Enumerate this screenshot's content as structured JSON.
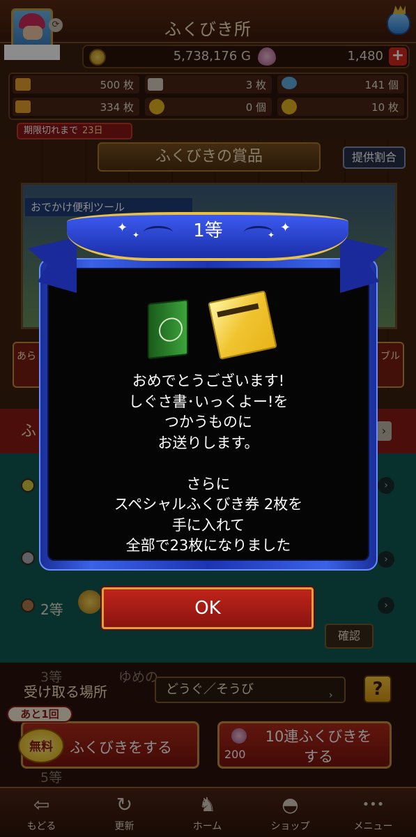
{
  "header": {
    "title": "ふくびき所"
  },
  "currency": {
    "gold": "5,738,176 G",
    "gems": "1,480",
    "plus": "+"
  },
  "inventory": [
    {
      "value": "500 枚",
      "icon_color": "#e8a030"
    },
    {
      "value": "3 枚",
      "icon_color": "#d8d0c0"
    },
    {
      "value": "141 個",
      "icon_color": "#60b0e0"
    },
    {
      "value": "334 枚",
      "icon_color": "#e8a030"
    },
    {
      "value": "0 個",
      "icon_color": "#e8b820"
    },
    {
      "value": "10 枚",
      "icon_color": "#e8b820"
    }
  ],
  "expire": {
    "label": "期限切れまで",
    "days": "23日"
  },
  "prizes": {
    "banner": "ふくびきの賞品",
    "rate_button": "提供割合",
    "showcase_label": "おでかけ便利ツール",
    "side_left": "あら",
    "side_right": "ブル"
  },
  "background_rows": {
    "red_band": "ふ",
    "rank2": "2等",
    "confirm": "確認",
    "rank3_behind": "3等",
    "yume_behind": "ゆめの",
    "rank5_behind": "5等"
  },
  "controls": {
    "receive_label": "受け取る場所",
    "receive_value": "どうぐ／そうび",
    "help": "?",
    "remaining": "あと1回",
    "free": "無料",
    "draw": "ふくびきをする",
    "draw10": "10連ふくびきを\nする",
    "draw10_cost": "200"
  },
  "tabs": [
    {
      "label": "もどる",
      "icon": "back-arrow-icon",
      "glyph": "⇦"
    },
    {
      "label": "更新",
      "icon": "refresh-icon",
      "glyph": "↻"
    },
    {
      "label": "ホーム",
      "icon": "dragon-icon",
      "glyph": "♞"
    },
    {
      "label": "ショップ",
      "icon": "slime-icon",
      "glyph": "◓"
    },
    {
      "label": "メニュー",
      "icon": "dots-icon",
      "glyph": "•••"
    }
  ],
  "modal": {
    "rank": "1等",
    "message": "おめでとうございます!\nしぐさ書･いっくよー!を\nつかうものに\nお送りします。\n\nさらに\nスペシャルふくびき券 2枚を\n手に入れて\n全部で23枚になりました",
    "ok": "OK",
    "accent_blue": "#1c34b0",
    "accent_gold": "#e8c04a"
  }
}
